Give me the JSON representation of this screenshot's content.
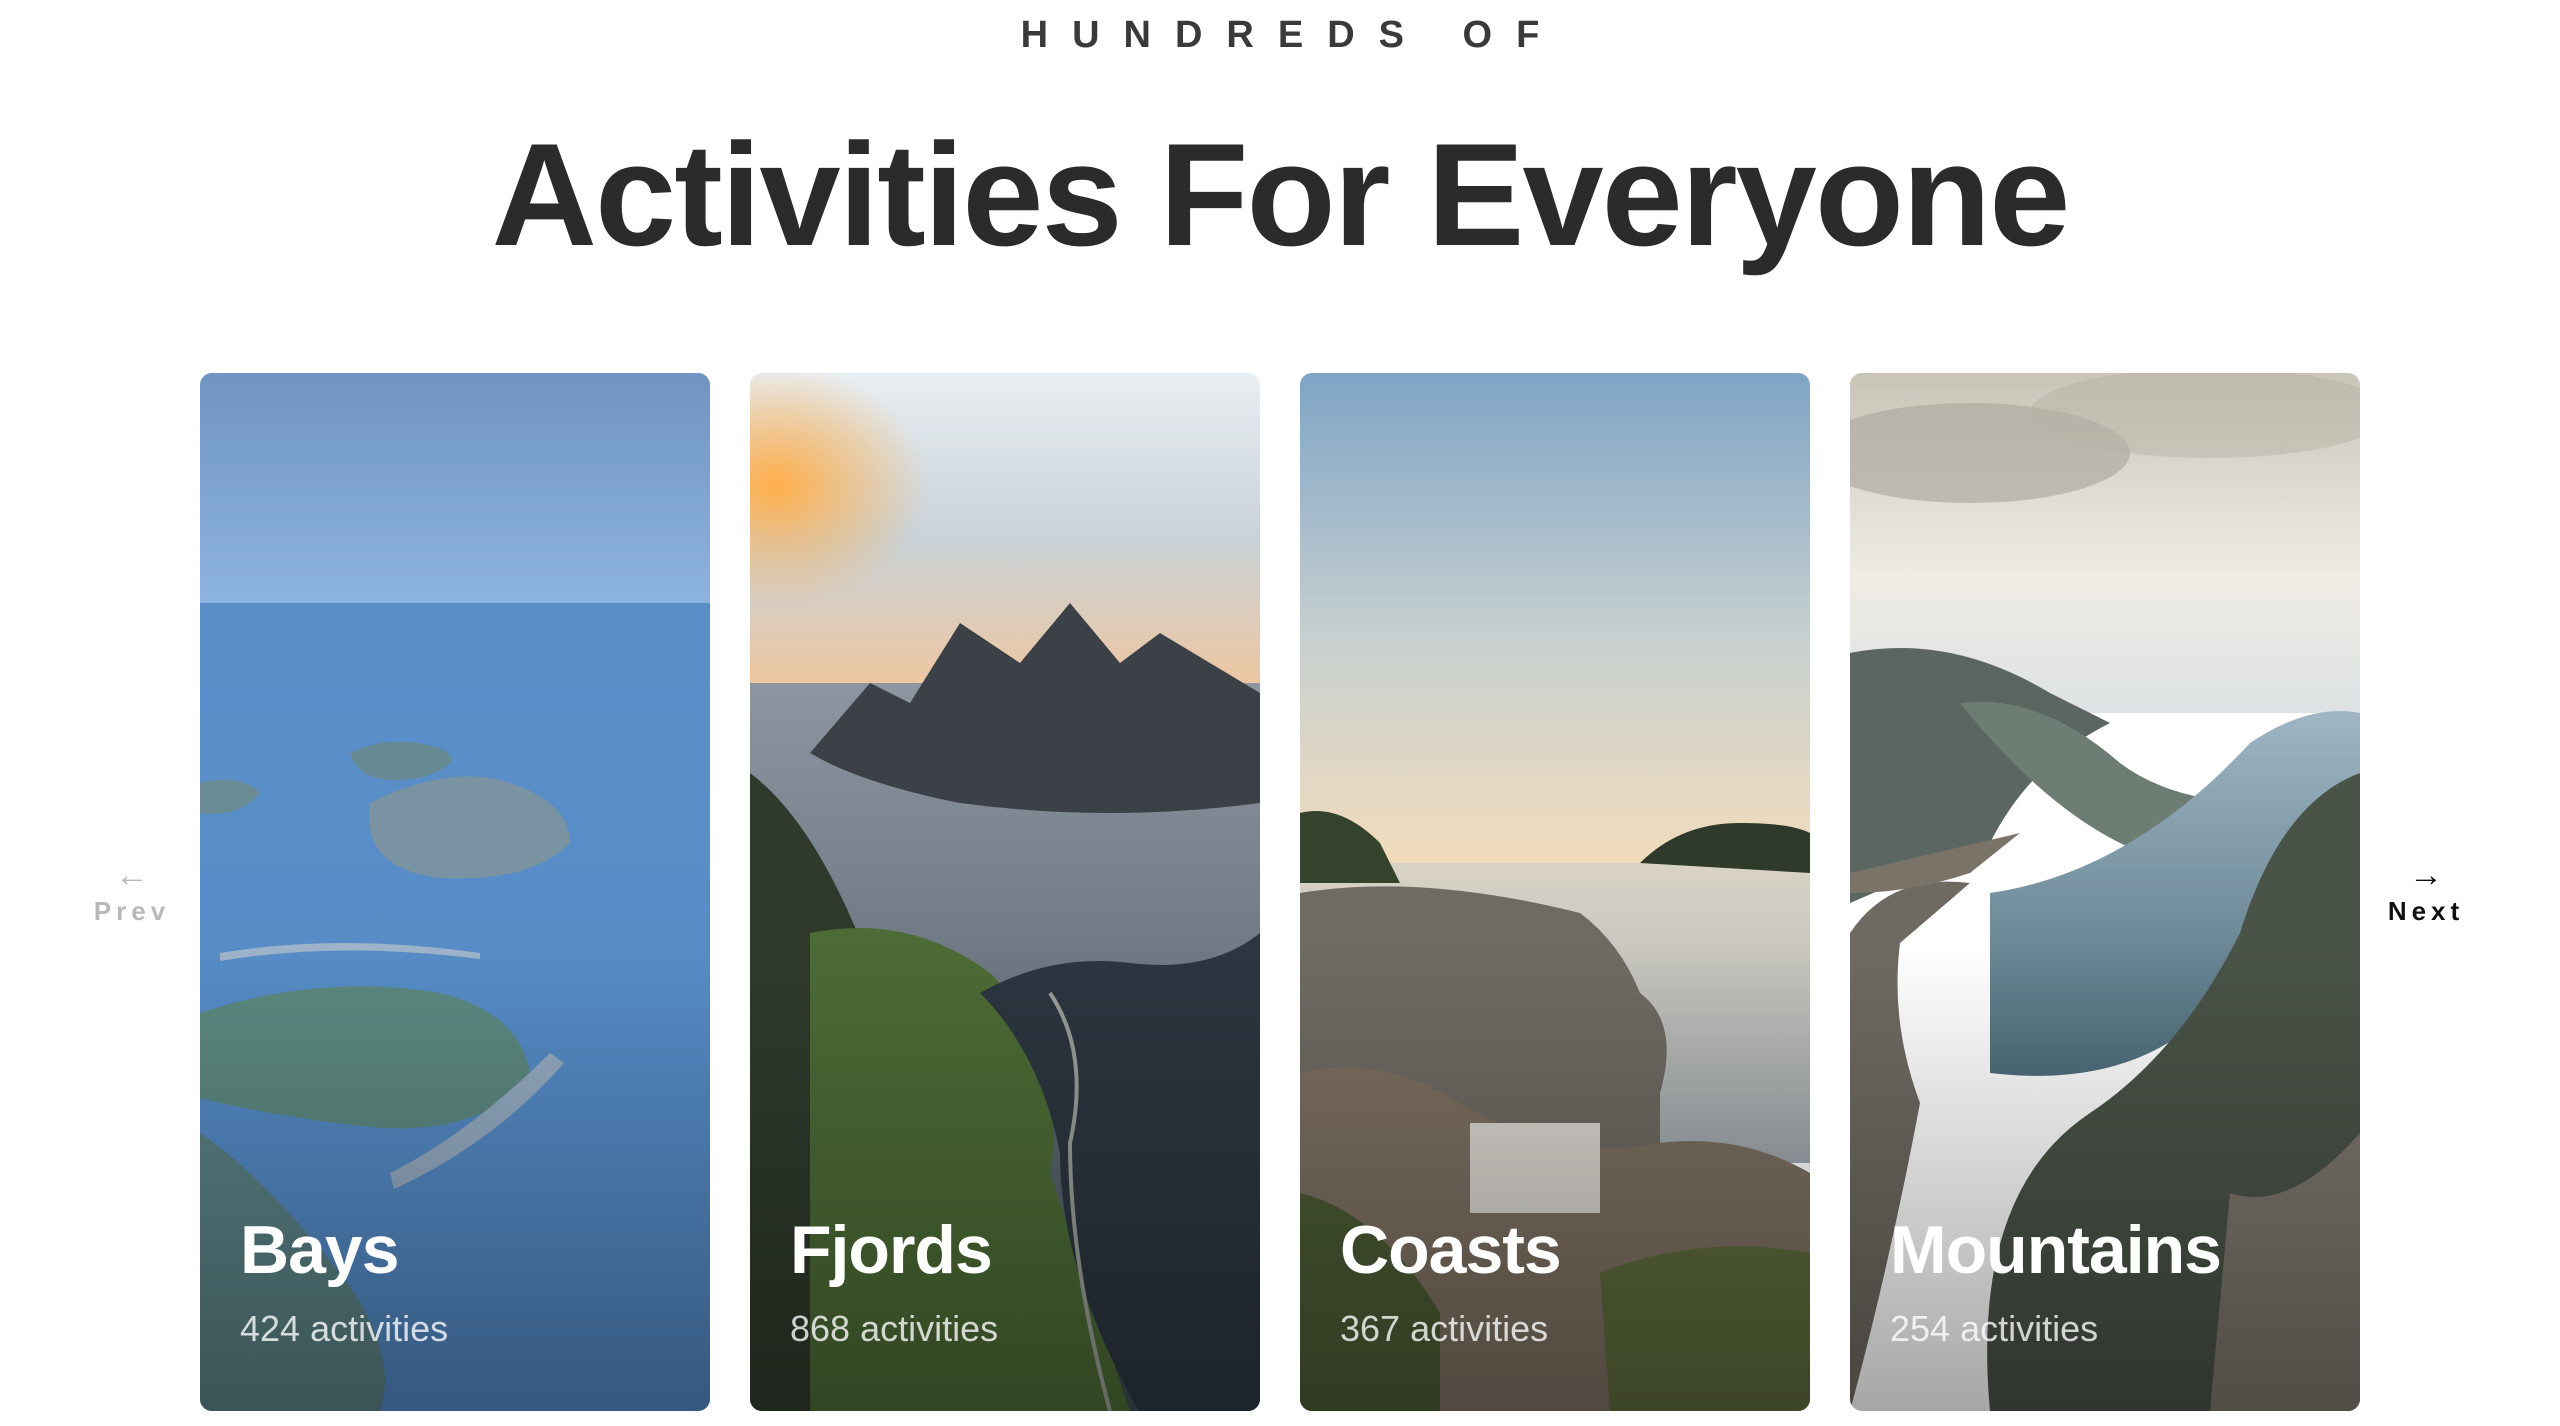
{
  "header": {
    "eyebrow": "HUNDREDS OF",
    "headline": "Activities For Everyone"
  },
  "nav": {
    "prev_label": "Prev",
    "next_label": "Next",
    "prev_arrow": "←",
    "next_arrow": "→"
  },
  "cards": [
    {
      "title": "Bays",
      "count": "424 activities"
    },
    {
      "title": "Fjords",
      "count": "868 activities"
    },
    {
      "title": "Coasts",
      "count": "367 activities"
    },
    {
      "title": "Mountains",
      "count": "254 activities"
    }
  ],
  "colors": {
    "heading": "#2b2b2b",
    "nav_inactive": "#b9b9b9",
    "nav_active": "#111111"
  }
}
